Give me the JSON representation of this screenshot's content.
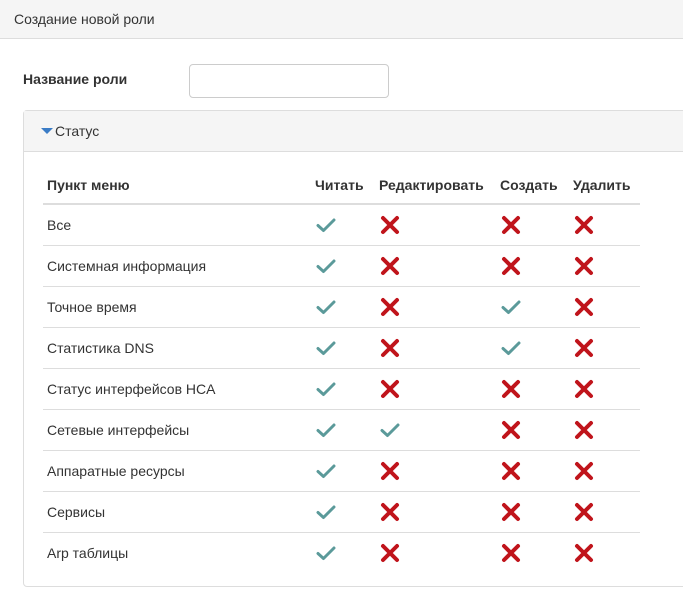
{
  "header": {
    "title": "Создание новой роли"
  },
  "form": {
    "role_label": "Название роли",
    "role_value": "",
    "role_placeholder": ""
  },
  "panel": {
    "title": "Статус"
  },
  "table": {
    "columns": [
      "Пункт меню",
      "Читать",
      "Редактировать",
      "Создать",
      "Удалить"
    ],
    "rows": [
      {
        "name": "Все",
        "read": true,
        "edit": false,
        "create": false,
        "delete": false
      },
      {
        "name": "Системная информация",
        "read": true,
        "edit": false,
        "create": false,
        "delete": false
      },
      {
        "name": "Точное время",
        "read": true,
        "edit": false,
        "create": true,
        "delete": false
      },
      {
        "name": "Статистика DNS",
        "read": true,
        "edit": false,
        "create": true,
        "delete": false
      },
      {
        "name": "Статус интерфейсов HCA",
        "read": true,
        "edit": false,
        "create": false,
        "delete": false
      },
      {
        "name": "Сетевые интерфейсы",
        "read": true,
        "edit": true,
        "create": false,
        "delete": false
      },
      {
        "name": "Аппаратные ресурсы",
        "read": true,
        "edit": false,
        "create": false,
        "delete": false
      },
      {
        "name": "Сервисы",
        "read": true,
        "edit": false,
        "create": false,
        "delete": false
      },
      {
        "name": "Arp таблицы",
        "read": true,
        "edit": false,
        "create": false,
        "delete": false
      }
    ]
  },
  "icons": {
    "allowed": "check-icon",
    "denied": "cross-icon",
    "allowed_color": "#5b9a9a",
    "denied_color": "#c0141b",
    "collapse": "caret-down-icon"
  }
}
